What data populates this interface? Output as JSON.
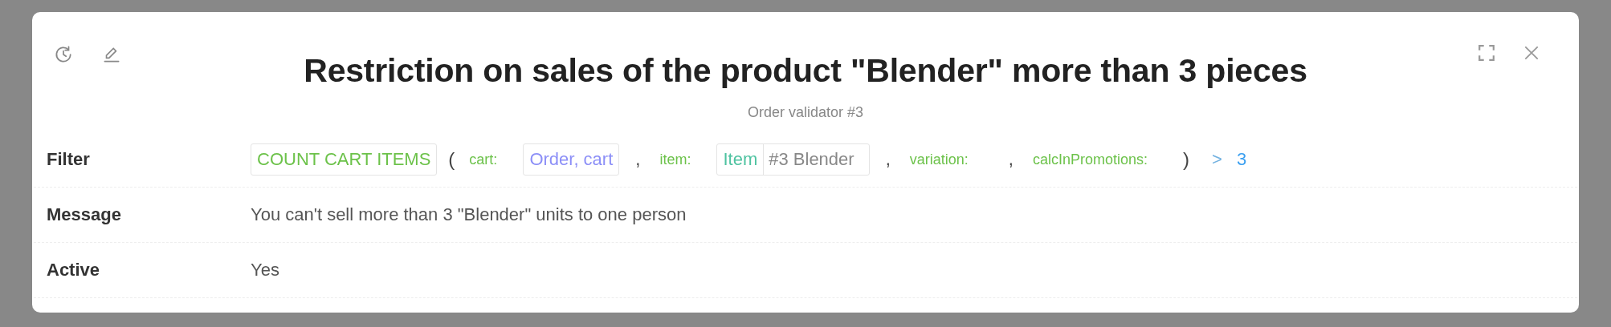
{
  "dialog": {
    "title": "Restriction on sales of the product \"Blender\" more than 3 pieces",
    "subtitle": "Order validator #3"
  },
  "fields": [
    {
      "label": "Filter",
      "kind": "expression",
      "tokens": [
        {
          "kind": "function",
          "text": "COUNT CART ITEMS"
        },
        {
          "kind": "paren",
          "text": "("
        },
        {
          "kind": "param",
          "text": "cart:"
        },
        {
          "kind": "value",
          "text": "Order, cart"
        },
        {
          "kind": "comma",
          "text": ","
        },
        {
          "kind": "param",
          "text": "item:"
        },
        {
          "kind": "entity",
          "type": "Item",
          "text": "#3 Blender"
        },
        {
          "kind": "comma",
          "text": ","
        },
        {
          "kind": "param",
          "text": "variation:"
        },
        {
          "kind": "comma",
          "text": ","
        },
        {
          "kind": "param",
          "text": "calcInPromotions:"
        },
        {
          "kind": "paren",
          "text": ")"
        },
        {
          "kind": "operator",
          "text": ">"
        },
        {
          "kind": "number",
          "text": "3"
        }
      ]
    },
    {
      "label": "Message",
      "kind": "text",
      "value": "You can't sell more than 3 \"Blender\" units to one person"
    },
    {
      "label": "Active",
      "kind": "text",
      "value": "Yes"
    }
  ]
}
